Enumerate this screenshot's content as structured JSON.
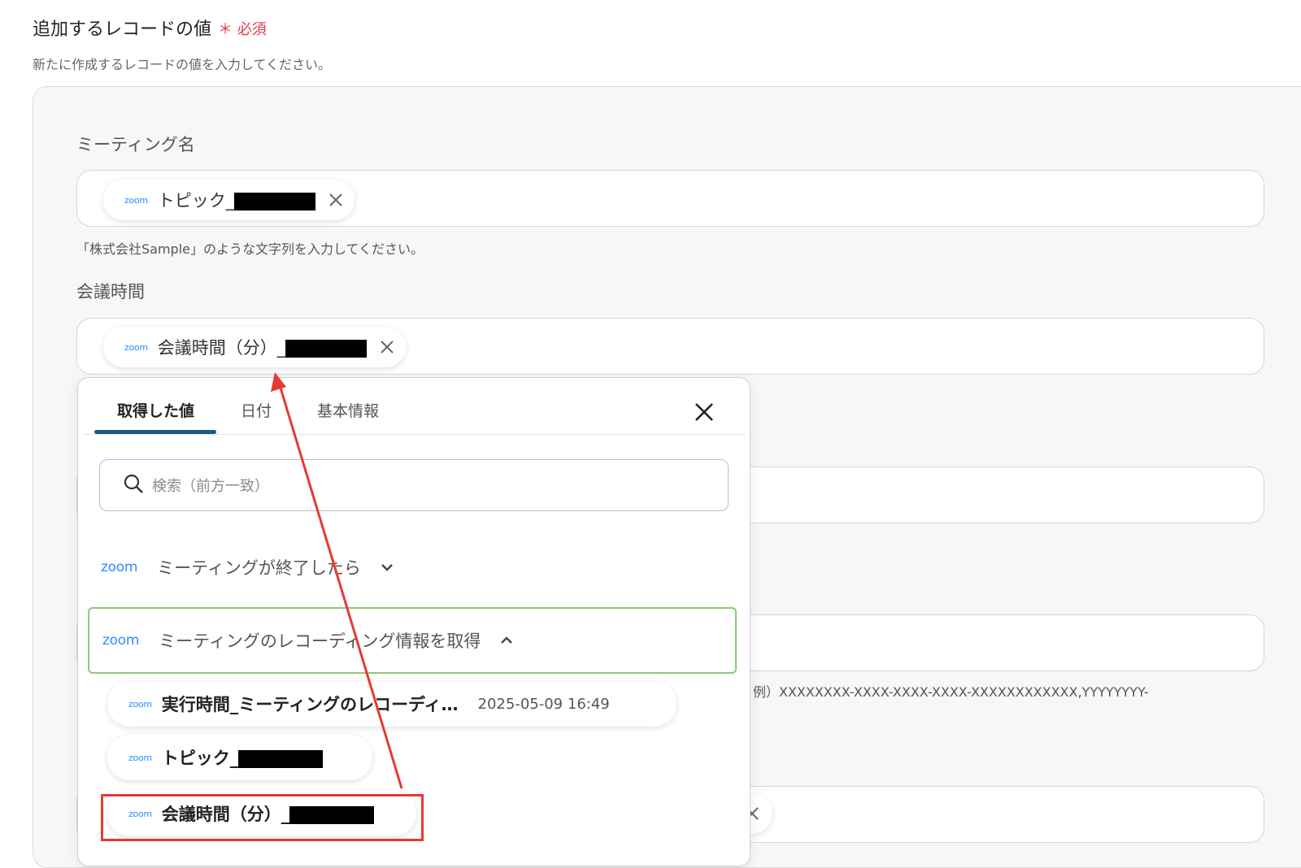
{
  "section": {
    "title": "追加するレコードの値",
    "required_mark": "＊",
    "required_label": "必須",
    "description": "新たに作成するレコードの値を入力してください。"
  },
  "fields": [
    {
      "label": "ミーティング名",
      "chip": {
        "source": "zoom",
        "text": "トピック_"
      },
      "hint": "「株式会社Sample」のような文字列を入力してください。"
    },
    {
      "label": "会議時間",
      "chip": {
        "source": "zoom",
        "text": "会議時間（分）_"
      }
    }
  ],
  "example_hint": "例）XXXXXXXX-XXXX-XXXX-XXXX-XXXXXXXXXXXX,YYYYYYYY-",
  "dropdown": {
    "tabs": [
      {
        "label": "取得した値",
        "active": true
      },
      {
        "label": "日付",
        "active": false
      },
      {
        "label": "基本情報",
        "active": false
      }
    ],
    "search_placeholder": "検索（前方一致）",
    "groups": [
      {
        "source": "zoom",
        "label": "ミーティングが終了したら",
        "expanded": false,
        "icon": "chevron-down-icon"
      },
      {
        "source": "zoom",
        "label": "ミーティングのレコーディング情報を取得",
        "expanded": true,
        "icon": "chevron-up-icon"
      }
    ],
    "values": [
      {
        "source": "zoom",
        "text": "実行時間_ミーティングのレコーディ…",
        "date": "2025-05-09 16:49"
      },
      {
        "source": "zoom",
        "text": "トピック_"
      },
      {
        "source": "zoom",
        "text": "会議時間（分）_"
      }
    ]
  },
  "colors": {
    "accent": "#1e5a7a",
    "zoom": "#2d8cff",
    "required": "#e53946",
    "selected_border": "#8cc97a",
    "annotation": "#e53935"
  }
}
